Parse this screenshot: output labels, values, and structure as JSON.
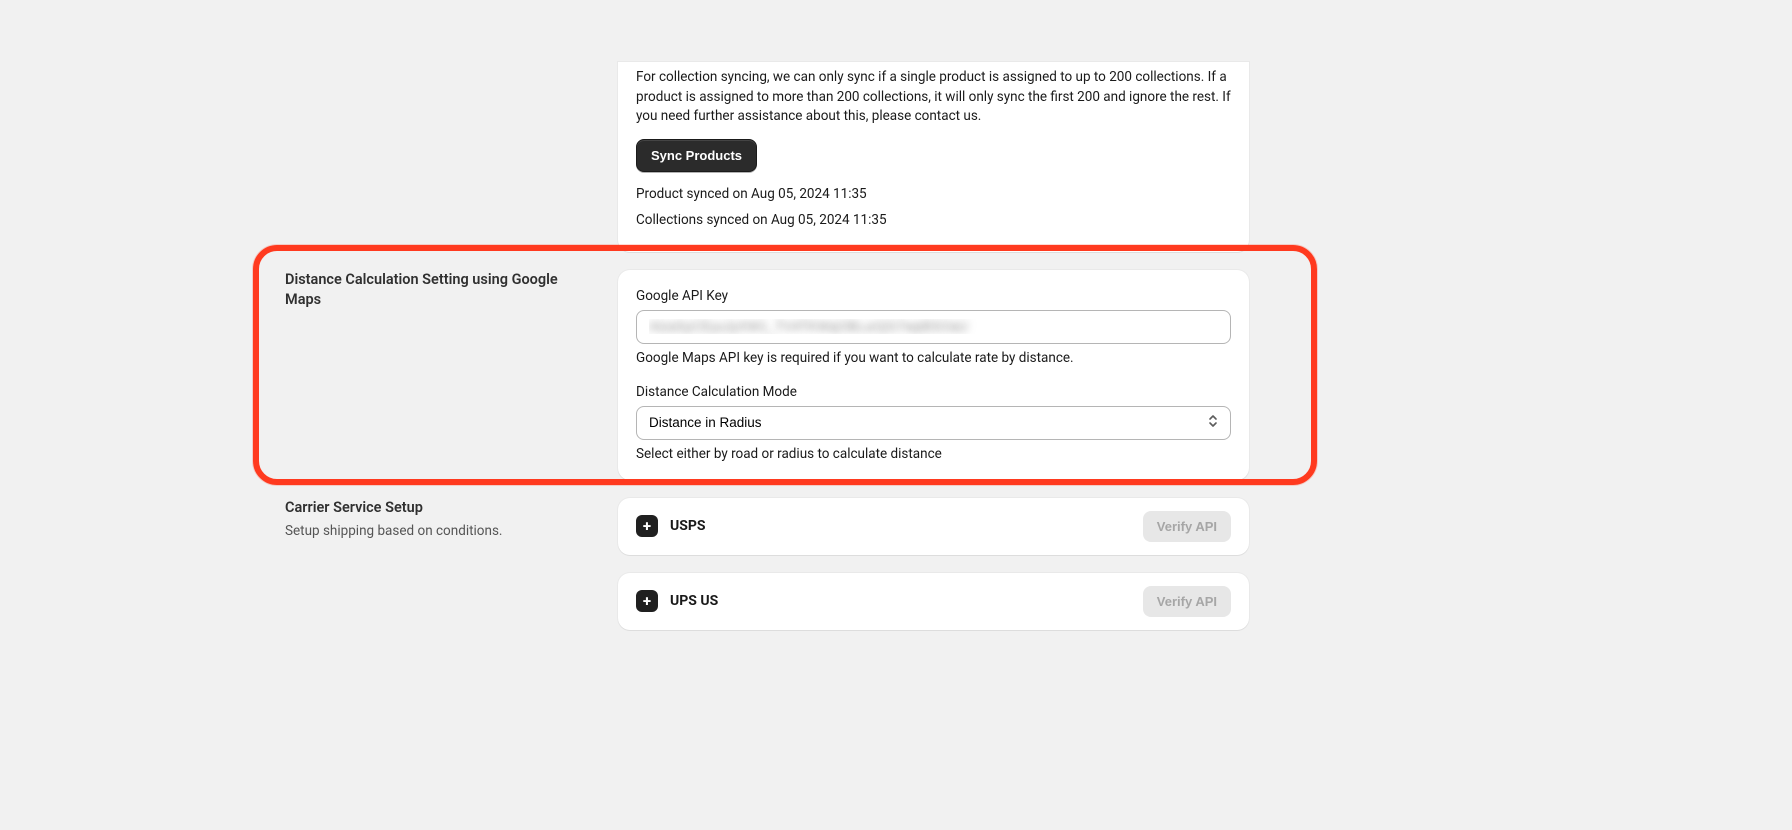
{
  "sync": {
    "description": "For collection syncing, we can only sync if a single product is assigned to up to 200 collections. If a product is assigned to more than 200 collections, it will only sync the first 200 and ignore the rest. If you need further assistance about this, please contact us.",
    "button_label": "Sync Products",
    "product_synced": "Product synced on Aug 05, 2024 11:35",
    "collections_synced": "Collections synced on Aug 05, 2024 11:35"
  },
  "distance": {
    "title": "Distance Calculation Setting using Google Maps",
    "api_key_label": "Google API Key",
    "api_key_value": "AIzaSyCEyuJyXW1_TV4TKWqOBLurQG7wpBSOaU",
    "api_key_help": "Google Maps API key is required if you want to calculate rate by distance.",
    "mode_label": "Distance Calculation Mode",
    "mode_value": "Distance in Radius",
    "mode_help": "Select either by road or radius to calculate distance"
  },
  "carrier": {
    "title": "Carrier Service Setup",
    "subtitle": "Setup shipping based on conditions.",
    "verify_label": "Verify API",
    "items": [
      {
        "name": "USPS"
      },
      {
        "name": "UPS US"
      }
    ]
  }
}
